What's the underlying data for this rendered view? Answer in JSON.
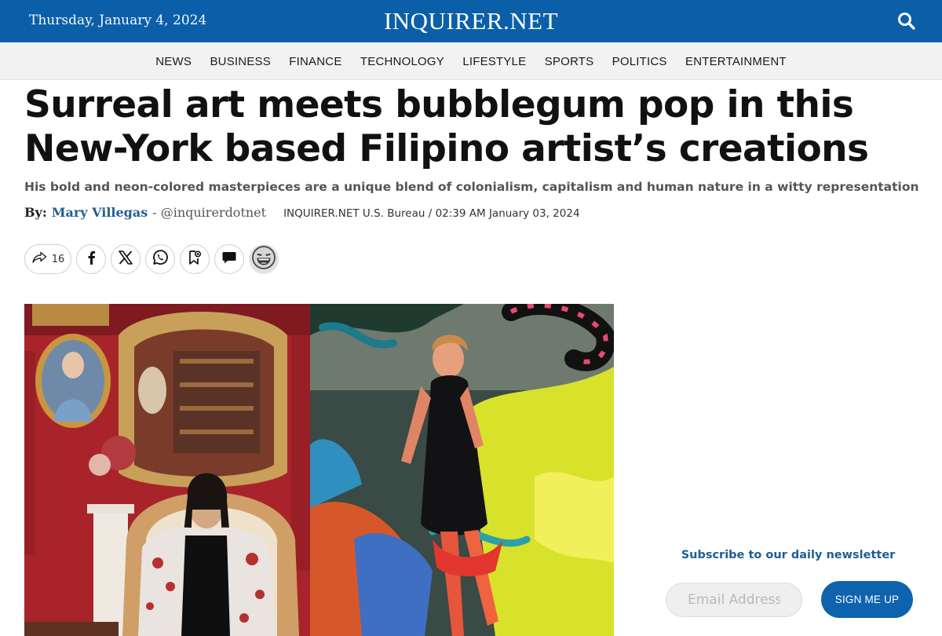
{
  "header": {
    "date": "Thursday, January 4, 2024",
    "logo": "INQUIRER.NET",
    "search_icon": "search-icon",
    "brand_color": "#0b5fa9"
  },
  "nav": {
    "items": [
      "NEWS",
      "BUSINESS",
      "FINANCE",
      "TECHNOLOGY",
      "LIFESTYLE",
      "SPORTS",
      "POLITICS",
      "ENTERTAINMENT"
    ]
  },
  "article": {
    "title": "Surreal art meets bubblegum pop in this New-York based Filipino artist’s creations",
    "subtitle": "His bold and neon-colored masterpieces are a unique blend of colonialism, capitalism and human nature in a witty representation",
    "byline_prefix": "By:",
    "author": "Mary Villegas",
    "handle": "- @inquirerdotnet",
    "bureau": "INQUIRER.NET U.S. Bureau / 02:39 AM January 03, 2024"
  },
  "share": {
    "count": "16",
    "buttons": [
      "share-arrow-icon",
      "facebook-icon",
      "x-icon",
      "whatsapp-icon",
      "bookmark-icon",
      "comment-icon",
      "laugh-emoji-icon"
    ]
  },
  "newsletter": {
    "title": "Subscribe to our daily newsletter",
    "email_placeholder": "Email Address",
    "button_label": "SIGN ME UP",
    "button_color": "#0f62ad"
  }
}
